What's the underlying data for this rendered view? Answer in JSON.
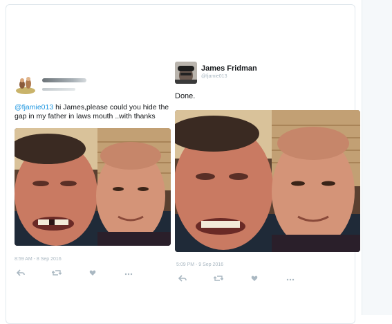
{
  "left_tweet": {
    "text_mention": "@fjamie013",
    "text_body": " hi James,please could you hide the gap in my father in laws mouth ..with thanks",
    "timestamp": "8:59 AM - 8 Sep 2016"
  },
  "right_tweet": {
    "name": "James Fridman",
    "handle": "@fjamie013",
    "text": "Done.",
    "timestamp": "5:09 PM - 9 Sep 2016"
  },
  "actions": {
    "reply_icon": "reply-icon",
    "retweet_icon": "retweet-icon",
    "like_icon": "heart-icon",
    "more_icon": "more-icon"
  },
  "colors": {
    "mention": "#1b95e0",
    "muted": "#aab8c2",
    "text": "#14171a"
  }
}
